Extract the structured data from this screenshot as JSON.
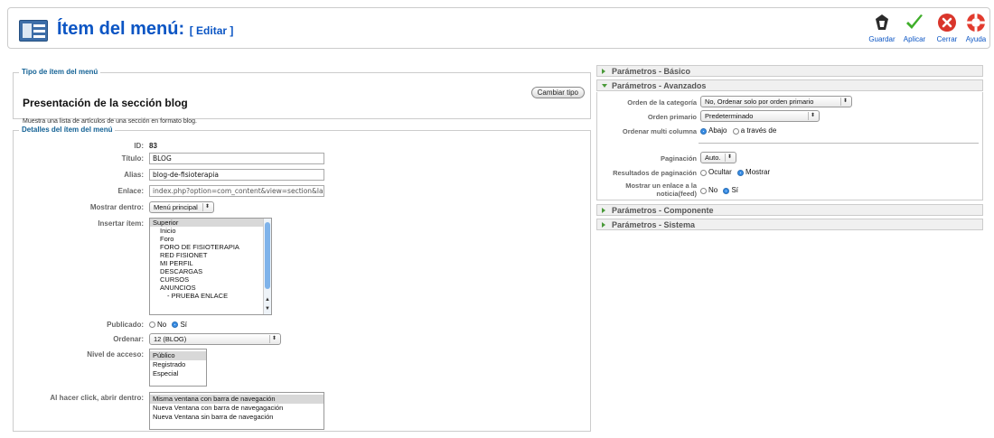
{
  "header": {
    "title": "Ítem del menú:",
    "edit_label": "[ Editar ]"
  },
  "toolbar": {
    "save_label": "Guardar",
    "apply_label": "Aplicar",
    "close_label": "Cerrar",
    "help_label": "Ayuda"
  },
  "type_section": {
    "legend": "Tipo de ítem del menú",
    "heading": "Presentación de la sección blog",
    "description": "Muestra una lista de artículos de una sección en formato blog.",
    "change_button": "Cambiar tipo"
  },
  "details": {
    "legend": "Detalles del ítem del menú",
    "id_label": "ID:",
    "id_value": "83",
    "title_label": "Título:",
    "title_value": "BLOG",
    "alias_label": "Alias:",
    "alias_value": "blog-de-fisioterapia",
    "link_label": "Enlace:",
    "link_value": "index.php?option=com_content&view=section&la",
    "display_in_label": "Mostrar dentro:",
    "display_in_value": "Menú principal",
    "insert_label": "Insertar ítem:",
    "insert_items": [
      "Superior",
      "Inicio",
      "Foro",
      "FORO DE FISIOTERAPIA",
      "RED FISIONET",
      "MI PERFIL",
      "DESCARGAS",
      "CURSOS",
      "ANUNCIOS",
      "- PRUEBA ENLACE"
    ],
    "published_label": "Publicado:",
    "no_label": "No",
    "yes_label": "Sí",
    "order_label": "Ordenar:",
    "order_value": "12 (BLOG)",
    "access_label": "Nivel de acceso:",
    "access_items": [
      "Público",
      "Registrado",
      "Especial"
    ],
    "click_label": "Al hacer click, abrir dentro:",
    "click_items": [
      "Misma ventana con barra de navegación",
      "Nueva Ventana con barra de navegagación",
      "Nueva Ventana sin barra de navegación"
    ]
  },
  "params": {
    "basic_title": "Parámetros - Básico",
    "advanced_title": "Parámetros - Avanzados",
    "component_title": "Parámetros - Componente",
    "system_title": "Parámetros - Sistema",
    "cat_order_label": "Orden de la categoría",
    "cat_order_value": "No, Ordenar solo por orden primario",
    "primary_order_label": "Orden primario",
    "primary_order_value": "Predeterminado",
    "multi_col_label": "Ordenar multi columna",
    "down_label": "Abajo",
    "across_label": "a través de",
    "pagination_label": "Paginación",
    "pagination_value": "Auto.",
    "pagination_results_label": "Resultados de paginación",
    "hide_label": "Ocultar",
    "show_label": "Mostrar",
    "feed_label_1": "Mostrar un enlace a la",
    "feed_label_2": "noticia(feed)",
    "no_label": "No",
    "yes_label": "Sí"
  }
}
